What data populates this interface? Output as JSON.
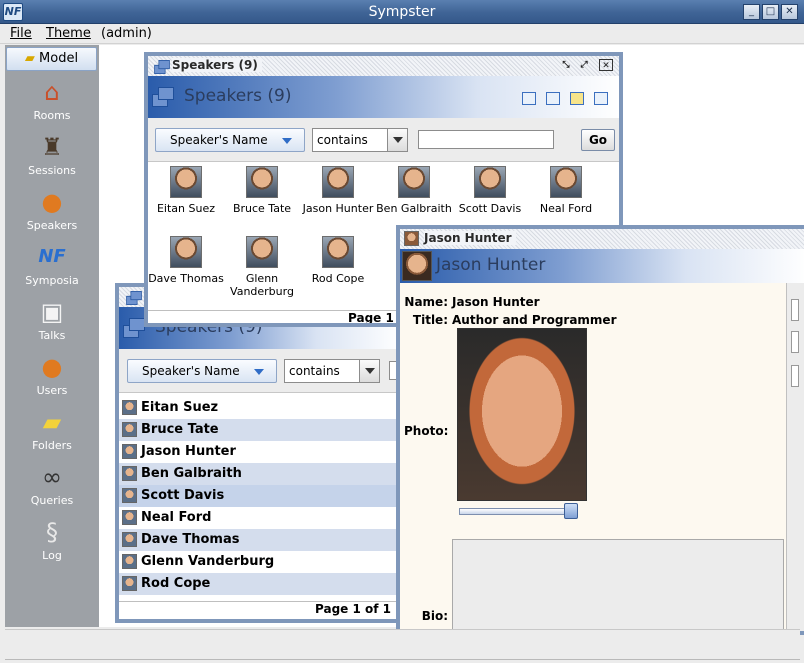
{
  "window": {
    "title": "Sympster"
  },
  "menu": {
    "file": "File",
    "theme": "Theme",
    "user": "(admin)"
  },
  "sidebar": {
    "header": "Model",
    "items": [
      {
        "label": "Rooms",
        "icon": "house-icon"
      },
      {
        "label": "Sessions",
        "icon": "sessions-icon"
      },
      {
        "label": "Speakers",
        "icon": "speaker-person-icon"
      },
      {
        "label": "Symposia",
        "icon": "nf-logo-icon"
      },
      {
        "label": "Talks",
        "icon": "easel-icon"
      },
      {
        "label": "Users",
        "icon": "user-person-icon"
      },
      {
        "label": "Folders",
        "icon": "folder-icon"
      },
      {
        "label": "Queries",
        "icon": "binoculars-icon"
      },
      {
        "label": "Log",
        "icon": "scroll-icon"
      }
    ]
  },
  "speakers_grid": {
    "window_title": "Speakers (9)",
    "heading": "Speakers (9)",
    "field_button": "Speaker's Name",
    "operator": "contains",
    "search_value": "",
    "go_label": "Go",
    "page_label": "Page 1 of 1",
    "speakers": [
      "Eitan Suez",
      "Bruce Tate",
      "Jason Hunter",
      "Ben Galbraith",
      "Scott Davis",
      "Neal Ford",
      "Dave Thomas",
      "Glenn Vanderburg",
      "Rod Cope"
    ]
  },
  "speakers_list": {
    "heading": "Speakers (9)",
    "field_button": "Speaker's Name",
    "operator": "contains",
    "page_label": "Page 1 of 1",
    "speakers": [
      "Eitan Suez",
      "Bruce Tate",
      "Jason Hunter",
      "Ben Galbraith",
      "Scott Davis",
      "Neal Ford",
      "Dave Thomas",
      "Glenn Vanderburg",
      "Rod Cope"
    ]
  },
  "detail": {
    "window_title": "Jason Hunter",
    "heading": "Jason Hunter",
    "name_label": "Name:",
    "name_value": "Jason Hunter",
    "title_label": "Title:",
    "title_value": "Author and Programmer",
    "photo_label": "Photo:",
    "bio_label": "Bio:",
    "bio_value": "",
    "photo_zoom": 0.95
  },
  "colors": {
    "titlebar": "#3f6496",
    "header_accent": "#2a5cab",
    "sidebar": "#9da1a6",
    "list_alt_row": "#d4dded",
    "detail_bg": "#fdf9f0"
  }
}
